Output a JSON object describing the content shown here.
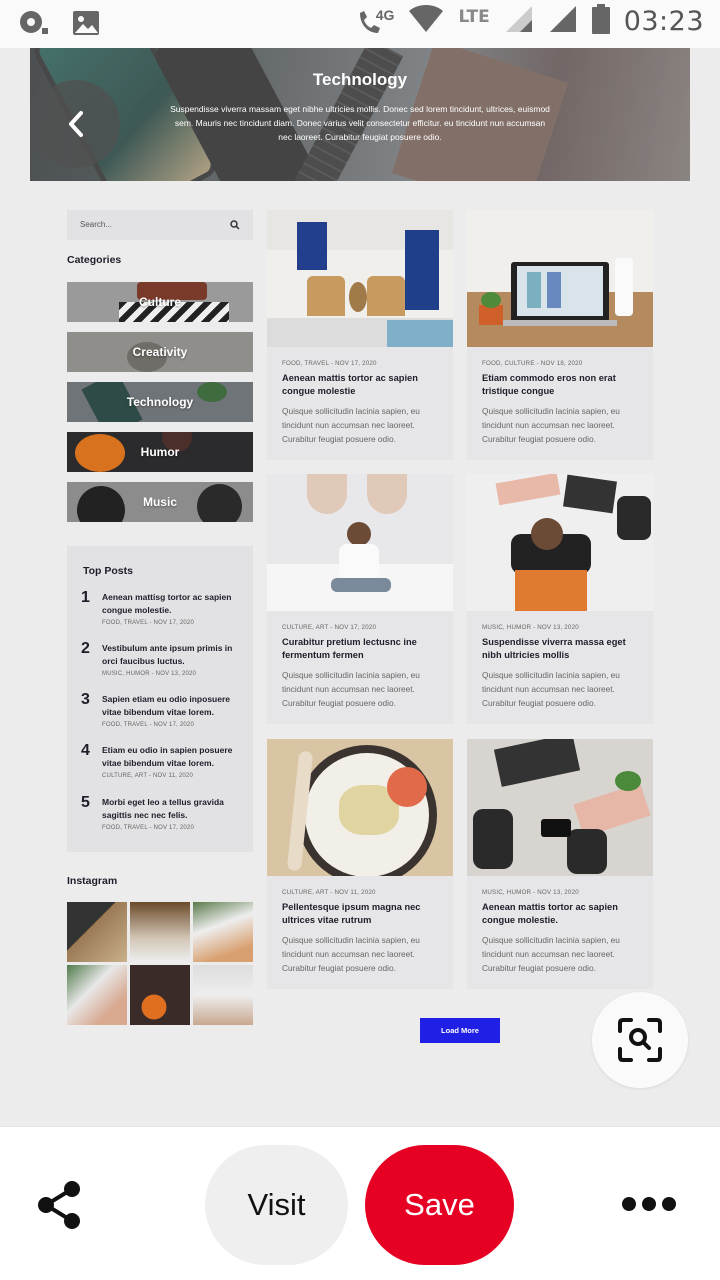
{
  "status_bar": {
    "network": "4G",
    "lte": "LTE",
    "time": "03:23"
  },
  "hero": {
    "title": "Technology",
    "description": "Suspendisse viverra massam eget nibhe ultricies mollis. Donec sed lorem tincidunt, ultrices, euismod sem. Mauris nec tincidunt diam. Donec varius velit consectetur efficitur. eu tincidunt nun accumsan nec laoreet. Curabitur feugiat posuere odio."
  },
  "sidebar": {
    "search_placeholder": "Search...",
    "categories_title": "Categories",
    "categories": [
      "Culture",
      "Creativity",
      "Technology",
      "Humor",
      "Music"
    ],
    "top_posts_title": "Top Posts",
    "top_posts": [
      {
        "num": "1",
        "title": "Aenean mattisg tortor ac sapien congue molestie.",
        "meta": "FOOD, TRAVEL - NOV 17, 2020"
      },
      {
        "num": "2",
        "title": "Vestibulum ante ipsum primis in orci faucibus luctus.",
        "meta": "MUSIC, HUMOR - NOV 13, 2020"
      },
      {
        "num": "3",
        "title": "Sapien etiam eu odio inposuere vitae bibendum vitae lorem.",
        "meta": "FOOD, TRAVEL - NOV 17, 2020"
      },
      {
        "num": "4",
        "title": "Etiam eu odio in sapien posuere vitae bibendum vitae lorem.",
        "meta": "CULTURE, ART - NOV 11, 2020"
      },
      {
        "num": "5",
        "title": "Morbi eget leo a tellus gravida sagittis nec nec felis.",
        "meta": "FOOD, TRAVEL - NOV 17, 2020"
      }
    ],
    "instagram_title": "Instagram"
  },
  "cards": [
    {
      "meta": "FOOD, TRAVEL - NOV 17, 2020",
      "title": "Aenean mattis tortor ac sapien congue molestie",
      "excerpt": "Quisque sollicitudin lacinia sapien, eu tincidunt nun accumsan nec laoreet. Curabitur feugiat posuere odio."
    },
    {
      "meta": "FOOD, CULTURE - NOV 18, 2020",
      "title": "Etiam commodo eros non erat tristique congue",
      "excerpt": "Quisque sollicitudin lacinia sapien, eu tincidunt nun accumsan nec laoreet. Curabitur feugiat posuere odio."
    },
    {
      "meta": "CULTURE, ART - NOV 17, 2020",
      "title": "Curabitur pretium lectusnc ine fermentum fermen",
      "excerpt": "Quisque sollicitudin lacinia sapien, eu tincidunt nun accumsan nec laoreet. Curabitur feugiat posuere odio."
    },
    {
      "meta": "MUSIC, HUMOR - NOV 13, 2020",
      "title": "Suspendisse viverra massa eget nibh ultricies mollis",
      "excerpt": "Quisque sollicitudin lacinia sapien, eu tincidunt nun accumsan nec laoreet. Curabitur feugiat posuere odio."
    },
    {
      "meta": "CULTURE, ART - NOV 11, 2020",
      "title": "Pellentesque ipsum magna nec ultrices vitae rutrum",
      "excerpt": "Quisque sollicitudin lacinia sapien, eu tincidunt nun accumsan nec laoreet. Curabitur feugiat posuere odio."
    },
    {
      "meta": "MUSIC, HUMOR - NOV 13, 2020",
      "title": "Aenean mattis tortor ac sapien congue molestie.",
      "excerpt": "Quisque sollicitudin lacinia sapien, eu tincidunt nun accumsan nec laoreet. Curabitur feugiat posuere odio."
    }
  ],
  "load_more_label": "Load More",
  "bottom_bar": {
    "visit_label": "Visit",
    "save_label": "Save"
  },
  "colors": {
    "save": "#e60023",
    "load_more": "#1f1fe6"
  }
}
